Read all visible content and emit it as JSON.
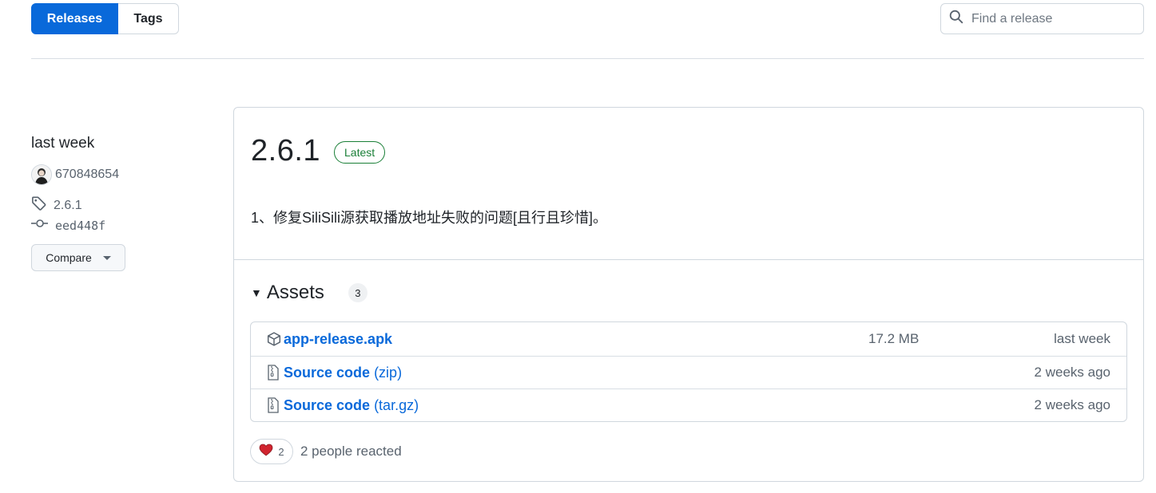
{
  "tabs": {
    "releases": "Releases",
    "tags": "Tags"
  },
  "search": {
    "placeholder": "Find a release"
  },
  "meta": {
    "date": "last week",
    "author": "670848654",
    "tag": "2.6.1",
    "commit": "eed448f",
    "compare_label": "Compare"
  },
  "release": {
    "title": "2.6.1",
    "badge": "Latest",
    "body": "1、修复SiliSili源获取播放地址失败的问题[且行且珍惜]。"
  },
  "assets": {
    "title": "Assets",
    "count": "3",
    "items": [
      {
        "name": "app-release.apk",
        "ext": "",
        "size": "17.2 MB",
        "date": "last week",
        "icon": "package-icon"
      },
      {
        "name": "Source code",
        "ext": "(zip)",
        "size": "",
        "date": "2 weeks ago",
        "icon": "file-zip-icon"
      },
      {
        "name": "Source code",
        "ext": "(tar.gz)",
        "size": "",
        "date": "2 weeks ago",
        "icon": "file-zip-icon"
      }
    ]
  },
  "reactions": {
    "heart_count": "2",
    "summary": "2 people reacted"
  },
  "colors": {
    "accent": "#0969da",
    "latest": "#1a7f37",
    "heart": "#d1242f"
  }
}
